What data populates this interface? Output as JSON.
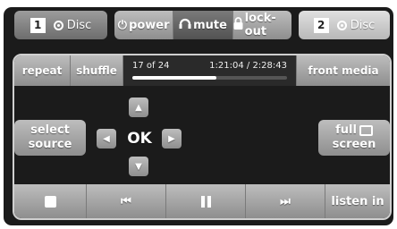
{
  "disc_left": {
    "number": "1",
    "label": "Disc",
    "icon": "disc-icon"
  },
  "disc_right": {
    "number": "2",
    "label": "Disc",
    "icon": "disc-icon"
  },
  "top_controls": {
    "power": "power",
    "mute": "mute",
    "lockout": "lock-out",
    "power_icon": "power-icon",
    "mute_icon": "headphones-icon",
    "lockout_icon": "padlock-icon"
  },
  "transport_strip": {
    "repeat": "repeat",
    "shuffle": "shuffle",
    "track": "17 of 24",
    "time": "1:21:04 / 2:28:43",
    "progress_fraction": 0.544,
    "front_media": "front media"
  },
  "navigation": {
    "select_source_line1": "select",
    "select_source_line2": "source",
    "ok": "OK",
    "up": "▲",
    "down": "▼",
    "left": "◀",
    "right": "▶",
    "full_screen_line1": "full",
    "full_screen_line2": "screen"
  },
  "bottom_controls": {
    "stop_icon": "stop-icon",
    "previous": "⏮",
    "pause_icon": "pause-icon",
    "next": "⏭",
    "listen_in": "listen in"
  },
  "colors": {
    "background": "#1b1b1b",
    "button_light": "#bdbdbd",
    "button_dark": "#8e8e8e",
    "text": "#ffffff"
  }
}
